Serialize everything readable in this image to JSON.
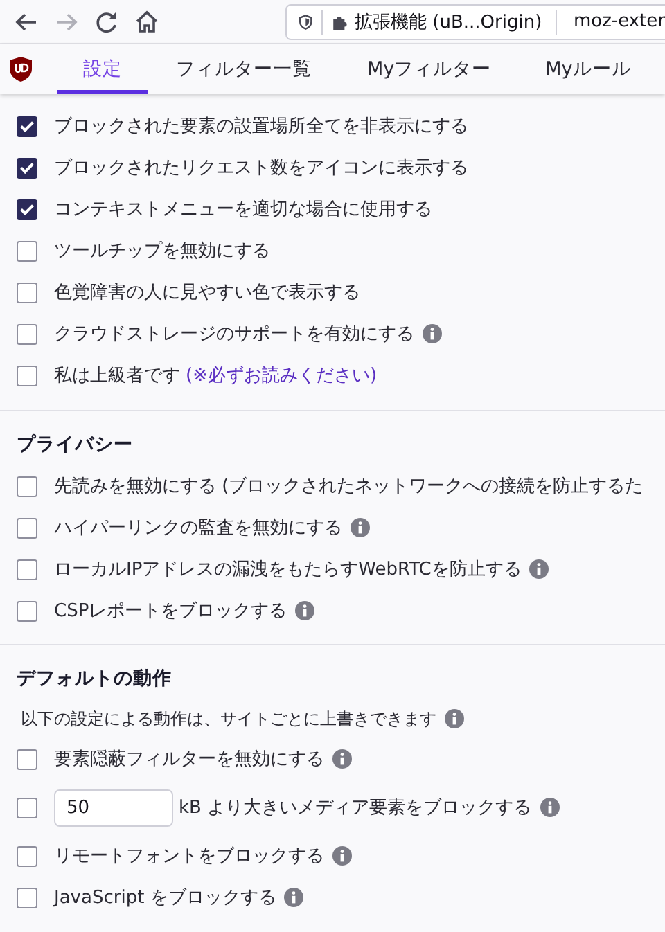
{
  "toolbar": {
    "back_disabled": false,
    "forward_disabled": true,
    "site_label": "拡張機能 (uB...Origin)",
    "url": "moz-exter"
  },
  "tabs": [
    {
      "label": "設定",
      "selected": true
    },
    {
      "label": "フィルター一覧",
      "selected": false
    },
    {
      "label": "Myフィルター",
      "selected": false
    },
    {
      "label": "Myルール",
      "selected": false
    }
  ],
  "sections": [
    {
      "options": [
        {
          "kind": "checkbox",
          "label": "ブロックされた要素の設置場所全てを非表示にする",
          "checked": true,
          "info": false
        },
        {
          "kind": "checkbox",
          "label": "ブロックされたリクエスト数をアイコンに表示する",
          "checked": true,
          "info": false
        },
        {
          "kind": "checkbox",
          "label": "コンテキストメニューを適切な場合に使用する",
          "checked": true,
          "info": false
        },
        {
          "kind": "checkbox",
          "label": "ツールチップを無効にする",
          "checked": false,
          "info": false
        },
        {
          "kind": "checkbox",
          "label": "色覚障害の人に見やすい色で表示する",
          "checked": false,
          "info": false
        },
        {
          "kind": "checkbox",
          "label": "クラウドストレージのサポートを有効にする",
          "checked": false,
          "info": true
        },
        {
          "kind": "checkbox",
          "label": "私は上級者です",
          "link": "(※必ずお読みください)",
          "checked": false,
          "info": false
        }
      ]
    },
    {
      "heading": "プライバシー",
      "options": [
        {
          "kind": "checkbox",
          "label": "先読みを無効にする (ブロックされたネットワークへの接続を防止するた",
          "checked": false,
          "info": false
        },
        {
          "kind": "checkbox",
          "label": "ハイパーリンクの監査を無効にする",
          "checked": false,
          "info": true
        },
        {
          "kind": "checkbox",
          "label": "ローカルIPアドレスの漏洩をもたらすWebRTCを防止する",
          "checked": false,
          "info": true
        },
        {
          "kind": "checkbox",
          "label": "CSPレポートをブロックする",
          "checked": false,
          "info": true
        }
      ]
    },
    {
      "heading": "デフォルトの動作",
      "note": "以下の設定による動作は、サイトごとに上書きできます",
      "note_info": true,
      "options": [
        {
          "kind": "checkbox",
          "label": "要素隠蔽フィルターを無効にする",
          "checked": false,
          "info": true
        },
        {
          "kind": "number",
          "field": {
            "value": "50"
          },
          "label": "kB より大きいメディア要素をブロックする",
          "checked": false,
          "info": true
        },
        {
          "kind": "checkbox",
          "label": "リモートフォントをブロックする",
          "checked": false,
          "info": true
        },
        {
          "kind": "checkbox",
          "label": "JavaScript をブロックする",
          "checked": false,
          "info": true
        }
      ]
    }
  ]
}
